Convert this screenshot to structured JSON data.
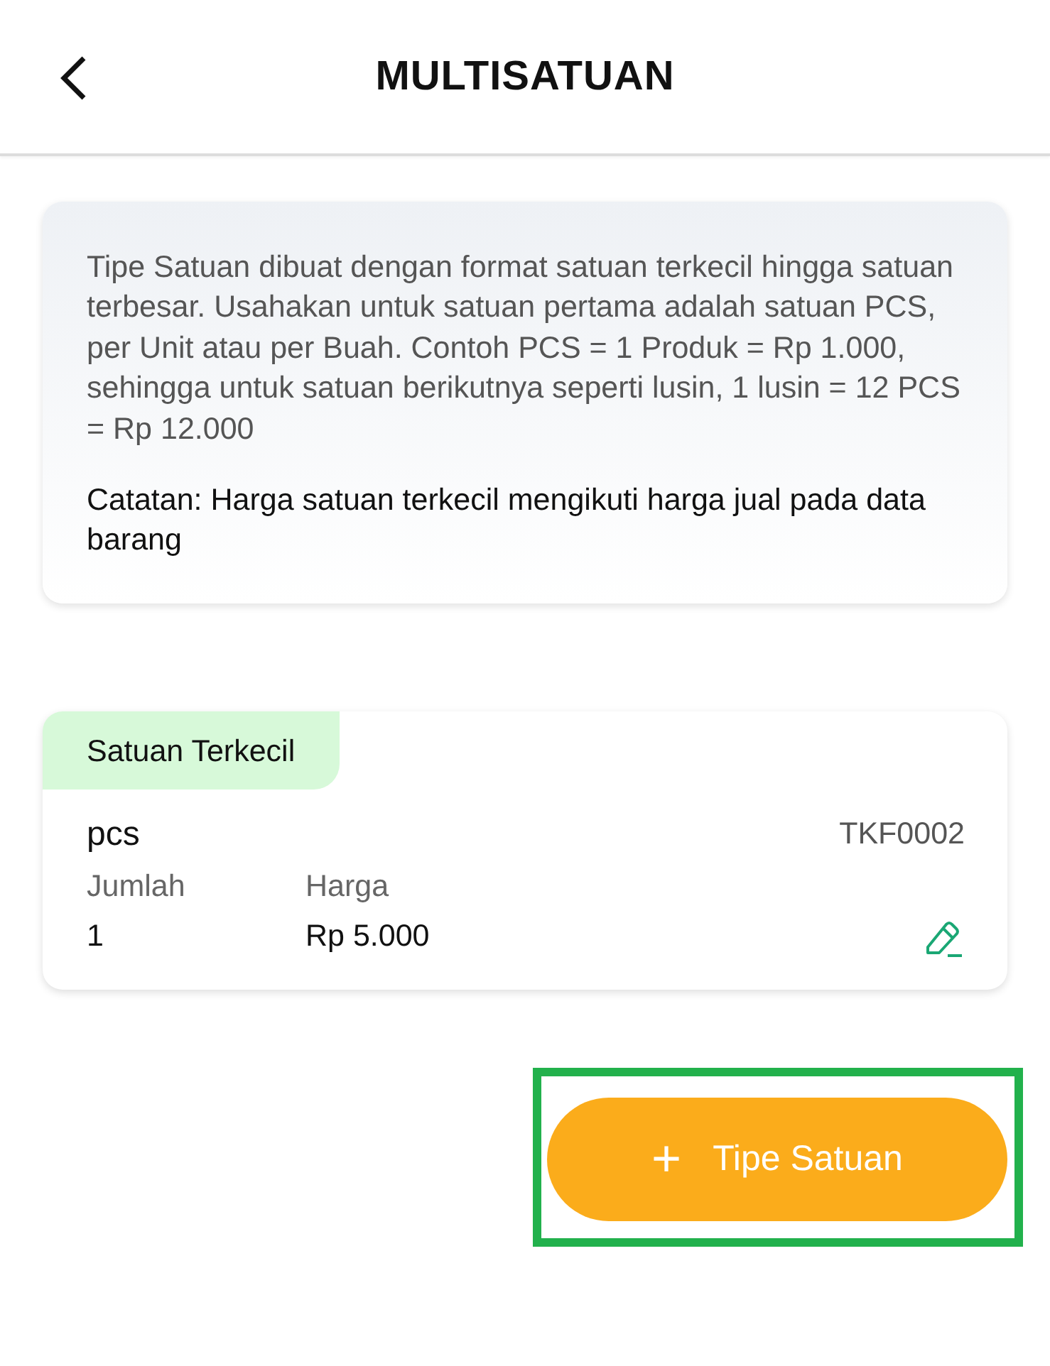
{
  "header": {
    "title": "MULTISATUAN"
  },
  "info": {
    "description": "Tipe Satuan dibuat dengan format satuan terkecil hingga satuan terbesar. Usahakan untuk satuan pertama adalah satuan PCS, per Unit atau per Buah. Contoh PCS = 1 Produk = Rp 1.000, sehingga untuk satuan berikutnya seperti lusin, 1 lusin = 12 PCS = Rp 12.000",
    "note": "Catatan: Harga satuan terkecil mengikuti harga jual pada data barang"
  },
  "units": [
    {
      "badge": "Satuan Terkecil",
      "name": "pcs",
      "code": "TKF0002",
      "qty_label": "Jumlah",
      "qty": "1",
      "price_label": "Harga",
      "price": "Rp 5.000"
    }
  ],
  "add_button": {
    "icon": "+",
    "label": "Tipe Satuan",
    "highlighted": true
  }
}
